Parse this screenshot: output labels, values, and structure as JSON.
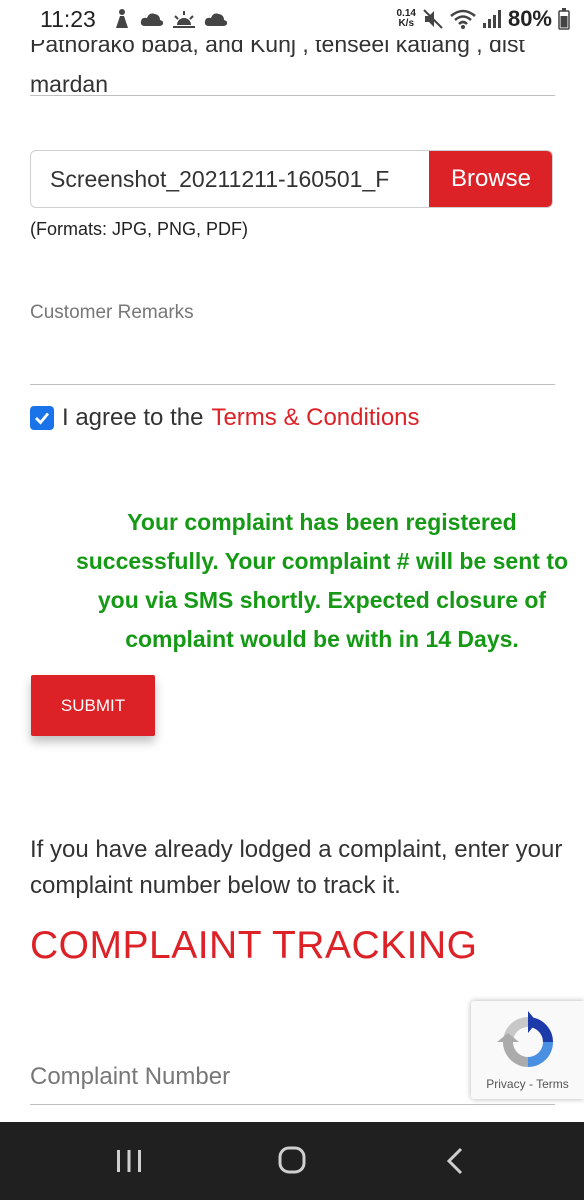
{
  "status_bar": {
    "time": "11:23",
    "net_speed_value": "0.14",
    "net_speed_unit": "K/s",
    "battery": "80%"
  },
  "form": {
    "address_text": "Pathorako baba, and Kunj , tenseel katlang , dist mardan",
    "file_name": "Screenshot_20211211-160501_F",
    "browse_label": "Browse",
    "formats_hint": "(Formats: JPG, PNG, PDF)",
    "remarks_placeholder": "Customer Remarks",
    "agree_prefix": "I agree to the",
    "terms_link": "Terms & Conditions",
    "agree_checked": true,
    "success_message": "Your complaint has been registered successfully. Your complaint # will be sent to you via SMS shortly. Expected closure of complaint would be with in 14 Days.",
    "submit_label": "SUBMIT"
  },
  "tracking": {
    "intro": "If you have already lodged a complaint, enter your complaint number below to track it.",
    "title": "COMPLAINT TRACKING",
    "complaint_number_placeholder": "Complaint Number"
  },
  "recaptcha": {
    "privacy": "Privacy",
    "separator": "-",
    "terms": "Terms"
  },
  "colors": {
    "accent_red": "#dc2127",
    "success_green": "#169a16",
    "checkbox_blue": "#1a73e8",
    "nav_bar": "#202020"
  },
  "icons": {
    "status_left": [
      "person-icon",
      "cloud-icon",
      "sunrise-icon",
      "cloud-icon"
    ],
    "status_right": [
      "mute-icon",
      "wifi-icon",
      "signal-icon",
      "battery-icon"
    ],
    "nav": [
      "recents-icon",
      "home-icon",
      "back-icon"
    ]
  }
}
